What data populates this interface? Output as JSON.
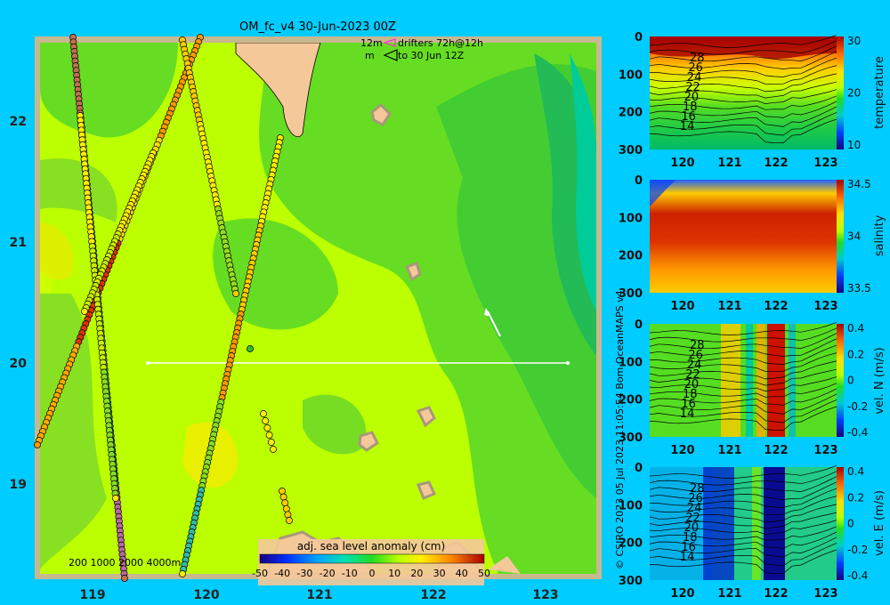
{
  "header": {
    "title": "OM_fc_v4  30-Jun-2023 00Z",
    "drifter_line1_a": "12m",
    "drifter_line1_b": "drifters 72h@12h",
    "drifter_line2_a": "m",
    "drifter_line2_b": "to 30 Jun 12Z"
  },
  "depth_legend": "200  1000  2000  4000m",
  "side_credit": "© CSIRO 2023   05 Jul 2023 11:05:54 Bom OceanMAPS v4",
  "chart_data": [
    {
      "type": "heatmap",
      "name": "map",
      "x_ticks": [
        "119",
        "120",
        "121",
        "122",
        "123"
      ],
      "y_ticks": [
        "22",
        "21",
        "20",
        "19"
      ],
      "xlim": [
        118.5,
        123.5
      ],
      "ylim": [
        18.2,
        22.7
      ],
      "colorbar": {
        "label": "adj. sea level anomaly (cm)",
        "ticks": [
          "-50",
          "-40",
          "-30",
          "-20",
          "-10",
          "0",
          "10",
          "20",
          "30",
          "40",
          "50"
        ],
        "range": [
          -50,
          50
        ]
      },
      "section_line": {
        "lon": [
          119.5,
          123.2
        ],
        "lat": [
          20.0,
          20.0
        ]
      },
      "current_arrow": {
        "from": [
          122.6,
          20.2
        ],
        "to": [
          122.45,
          20.45
        ]
      }
    },
    {
      "type": "heatmap",
      "name": "temperature section",
      "ylabel": "temperature",
      "x_ticks": [
        "120",
        "121",
        "122",
        "123"
      ],
      "y_ticks": [
        "0",
        "100",
        "200",
        "300"
      ],
      "cbar_ticks": [
        "30",
        "20",
        "10"
      ],
      "contour_labels": [
        "28",
        "26",
        "24",
        "22",
        "20",
        "18",
        "16",
        "14"
      ]
    },
    {
      "type": "heatmap",
      "name": "salinity section",
      "ylabel": "salinity",
      "x_ticks": [
        "120",
        "121",
        "122",
        "123"
      ],
      "y_ticks": [
        "0",
        "100",
        "200",
        "300"
      ],
      "cbar_ticks": [
        "34.5",
        "34",
        "33.5"
      ]
    },
    {
      "type": "heatmap",
      "name": "northward velocity section",
      "ylabel": "vel. N (m/s)",
      "x_ticks": [
        "120",
        "121",
        "122",
        "123"
      ],
      "y_ticks": [
        "0",
        "100",
        "200",
        "300"
      ],
      "cbar_ticks": [
        "0.4",
        "0.2",
        "0",
        "-0.2",
        "-0.4"
      ],
      "contour_labels": [
        "28",
        "26",
        "24",
        "22",
        "20",
        "18",
        "16",
        "14"
      ]
    },
    {
      "type": "heatmap",
      "name": "eastward velocity section",
      "ylabel": "vel. E (m/s)",
      "x_ticks": [
        "120",
        "121",
        "122",
        "123"
      ],
      "y_ticks": [
        "0",
        "100",
        "200",
        "300"
      ],
      "cbar_ticks": [
        "0.4",
        "0.2",
        "0",
        "-0.2",
        "-0.4"
      ],
      "contour_labels": [
        "28",
        "26",
        "24",
        "22",
        "20",
        "18",
        "16",
        "14"
      ]
    }
  ]
}
